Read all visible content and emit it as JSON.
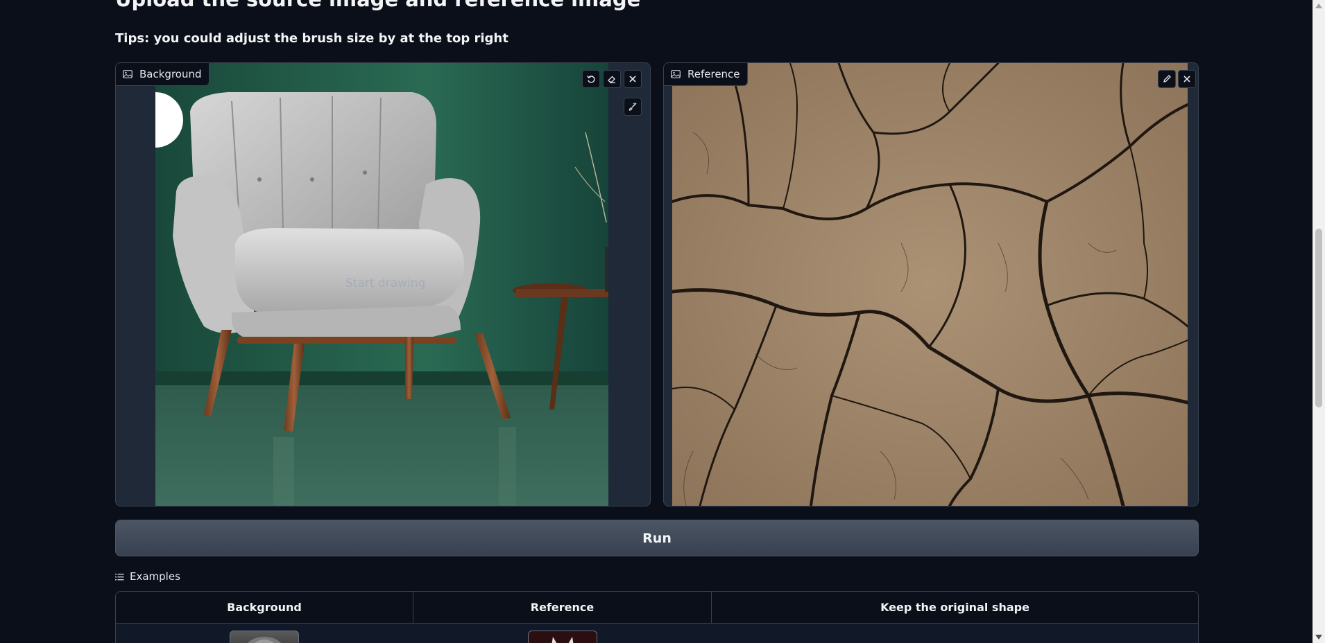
{
  "heading": "Upload the source image and reference image",
  "tips": "Tips: you could adjust the brush size by at the top right",
  "background_panel": {
    "label": "Background",
    "placeholder": "Start drawing"
  },
  "reference_panel": {
    "label": "Reference"
  },
  "run_button": "Run",
  "examples": {
    "label": "Examples",
    "columns": [
      "Background",
      "Reference",
      "Keep the original shape"
    ]
  },
  "icons": {
    "image": "image-icon",
    "undo": "undo-icon",
    "eraser": "eraser-icon",
    "close": "close-icon",
    "brush": "brush-icon",
    "edit": "pencil-icon",
    "list": "list-icon"
  },
  "colors": {
    "page_bg": "#0b0f19",
    "panel_bg": "#1f2937",
    "border": "#374151",
    "wall_green": "#1f5c45",
    "soil": "#a08466"
  }
}
